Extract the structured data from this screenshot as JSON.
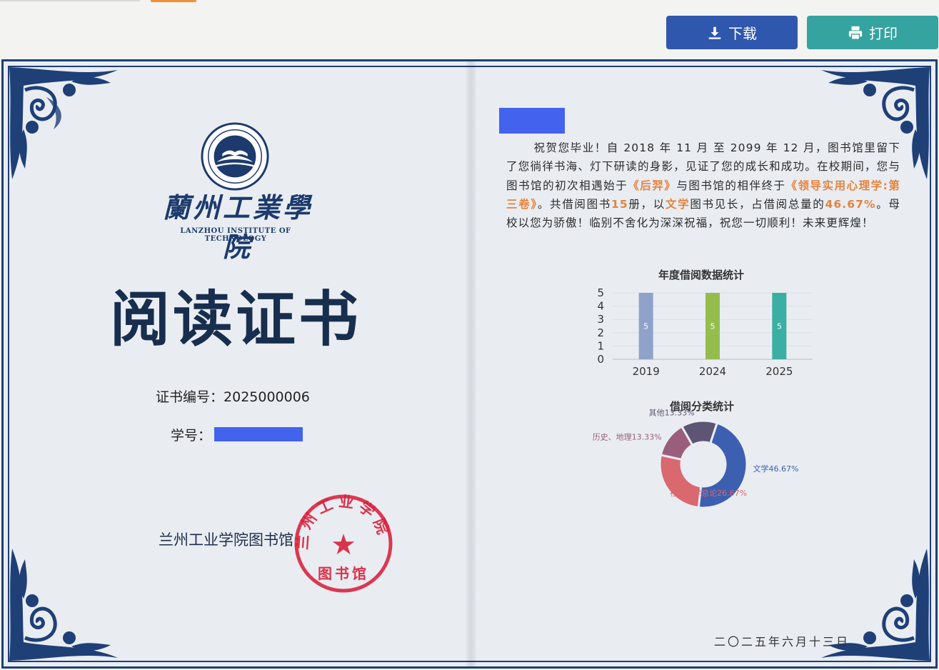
{
  "toolbar": {
    "download_label": "下载",
    "print_label": "打印",
    "download_icon": "download-icon",
    "print_icon": "printer-icon"
  },
  "certificate": {
    "university_cn": "蘭州工業學院",
    "university_en": "LANZHOU INSTITUTE OF TECHNOLOGY",
    "title": "阅读证书",
    "cert_no_label": "证书编号：",
    "cert_no_value": "2025000006",
    "student_no_label": "学号：",
    "library_name": "兰州工业学院图书馆",
    "seal_text": "兰州工业学院",
    "seal_sub": "图书馆",
    "seal_star": "★",
    "date": "二〇二五年六月十三日",
    "message": {
      "p1": "祝贺您毕业！自 2018 年 11 月 至 2099 年 12 月，图书馆里留下了您徜徉书海、灯下研读的身影，见证了您的成长和成功。在校期间，您与图书馆的初次相遇始于",
      "first_book": "《后羿》",
      "p2": "与图书馆的相伴终于",
      "last_book": "《领导实用心理学:第三卷》",
      "p3": "。共借阅图书",
      "count": "15",
      "p4": "册，以",
      "top_category": "文学",
      "p5": "图书见长，占借阅总量的",
      "percent": "46.67%",
      "p6": "。母校以您为骄傲！临别不舍化为深深祝福，祝您一切顺利！未来更辉煌！"
    }
  },
  "chart_data": [
    {
      "type": "bar",
      "title": "年度借阅数据统计",
      "categories": [
        "2019",
        "2024",
        "2025"
      ],
      "values": [
        5,
        5,
        5
      ],
      "ylim": [
        0,
        5
      ],
      "yticks": [
        0,
        1,
        2,
        3,
        4,
        5
      ],
      "grid": true,
      "colors": [
        "#8fa2c9",
        "#95bd4e",
        "#3bafa2"
      ]
    },
    {
      "type": "pie",
      "title": "借阅分类统计",
      "donut": true,
      "labels": [
        "文学46.67%",
        "社会科学总论26.67%",
        "历史、地理13.33%",
        "其他13.33%"
      ],
      "values": [
        46.67,
        26.67,
        13.33,
        13.33
      ],
      "colors": [
        "#3d5fb0",
        "#d9686f",
        "#9a5e7c",
        "#5e5474"
      ]
    }
  ]
}
